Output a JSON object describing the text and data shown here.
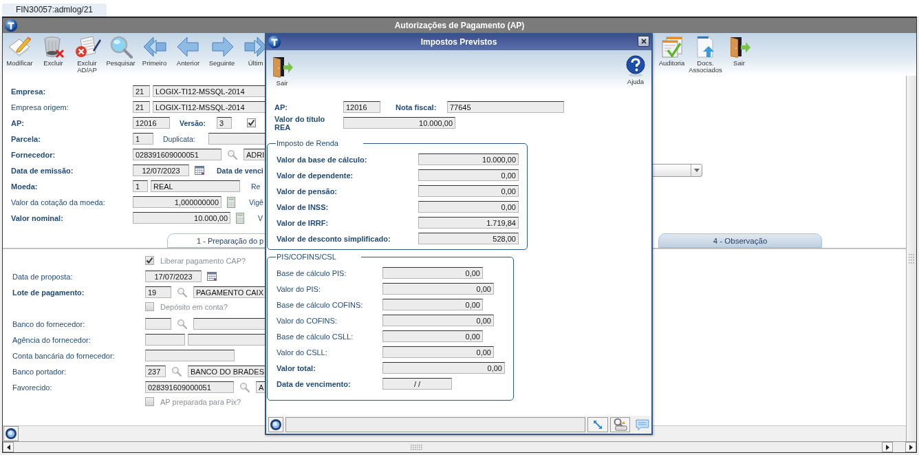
{
  "app_tab": {
    "label": "FIN30057:admlog/21",
    "selected": true
  },
  "window": {
    "title": "Autorizações de Pagamento (AP)"
  },
  "toolbar": [
    {
      "label": "Modificar"
    },
    {
      "label": "Excluir"
    },
    {
      "label": "Excluir AD/AP"
    },
    {
      "label": "Pesquisar"
    },
    {
      "label": "Primeiro"
    },
    {
      "label": "Anterior"
    },
    {
      "label": "Seguinte"
    },
    {
      "label": "Últim"
    }
  ],
  "toolbar_right": [
    {
      "label": "Auditoria"
    },
    {
      "label": "Docs. Associados"
    },
    {
      "label": "Sair"
    }
  ],
  "header": {
    "empresa": {
      "label": "Empresa:",
      "code": "21",
      "name": "LOGIX-TI12-MSSQL-2014"
    },
    "empresa_origem": {
      "label": "Empresa origem:",
      "code": "21",
      "name": "LOGIX-TI12-MSSQL-2014"
    },
    "ap": {
      "label": "AP:",
      "value": "12016",
      "versao_label": "Versão:",
      "versao": "3",
      "checked": true
    },
    "parcela": {
      "label": "Parcela:",
      "value": "1",
      "duplicata_label": "Duplicata:"
    },
    "fornecedor": {
      "label": "Fornecedor:",
      "code": "028391609000051",
      "name": "ADRI"
    },
    "data_emissao": {
      "label": "Data de emissão:",
      "value": "12/07/2023",
      "label_2": "Data de venci"
    },
    "moeda": {
      "label": "Moeda:",
      "code": "1",
      "name": "REAL",
      "label_2": "Re"
    },
    "cotacao": {
      "label": "Valor da cotação da moeda:",
      "value": "1,000000000",
      "label_2": "Vigê"
    },
    "valor_nominal": {
      "label": "Valor nominal:",
      "value": "10.000,00",
      "label_2": "V"
    }
  },
  "tabs": [
    {
      "label": "1 - Preparação do p",
      "selected": true
    },
    {
      "label": "4 - Observação",
      "selected": false
    }
  ],
  "payment": {
    "liberar": {
      "label": "Liberar pagamento CAP?",
      "checked": true,
      "disabled": true
    },
    "data_proposta": {
      "label": "Data de proposta:",
      "value": "17/07/2023"
    },
    "lote": {
      "label": "Lote de pagamento:",
      "code": "19",
      "name": "PAGAMENTO CAIX"
    },
    "deposito": {
      "label": "Depósito em conta?",
      "checked": false,
      "disabled": true
    },
    "banco_fornecedor": {
      "label": "Banco do fornecedor:"
    },
    "agencia": {
      "label": "Agência do fornecedor:"
    },
    "conta": {
      "label": "Conta bancária do fornecedor:"
    },
    "banco_portador": {
      "label": "Banco portador:",
      "code": "237",
      "name": "BANCO DO BRADES"
    },
    "favorecido": {
      "label": "Favorecido:",
      "code": "028391609000051",
      "name": "A"
    },
    "pix": {
      "label": "AP preparada para Pix?",
      "checked": false,
      "disabled": true
    }
  },
  "dialog": {
    "title": "Impostos Previstos",
    "toolbar": [
      {
        "label": "Sair"
      },
      {
        "label": "Ajuda"
      }
    ],
    "ap": {
      "label": "AP:",
      "value": "12016"
    },
    "nota_fiscal": {
      "label": "Nota fiscal:",
      "value": "77645"
    },
    "valor_titulo": {
      "label": "Valor do título REA",
      "value": "10.000,00"
    },
    "imposto_renda": {
      "title": "Imposto de Renda",
      "rows": [
        {
          "label": "Valor da base de cálculo:",
          "value": "10.000,00"
        },
        {
          "label": "Valor de dependente:",
          "value": "0,00"
        },
        {
          "label": "Valor de pensão:",
          "value": "0,00"
        },
        {
          "label": "Valor de INSS:",
          "value": "0,00"
        },
        {
          "label": "Valor de IRRF:",
          "value": "1.719,84"
        },
        {
          "label": "Valor de desconto simplificado:",
          "value": "528,00"
        }
      ]
    },
    "pis_cofins_csl": {
      "title": "PIS/COFINS/CSL",
      "rows": [
        {
          "label": "Base de cálculo PIS:",
          "value": "0,00"
        },
        {
          "label": "Valor do PIS:",
          "value": "0,00"
        },
        {
          "label": "Base de cálculo COFINS:",
          "value": "0,00"
        },
        {
          "label": "Valor do COFINS:",
          "value": "0,00"
        },
        {
          "label": "Base de cálculo CSLL:",
          "value": "0,00"
        },
        {
          "label": "Valor do CSLL:",
          "value": "0,00"
        },
        {
          "label": "Valor total:",
          "value": "0,00"
        },
        {
          "label": "Data de vencimento:",
          "value": "/ /"
        }
      ]
    }
  }
}
